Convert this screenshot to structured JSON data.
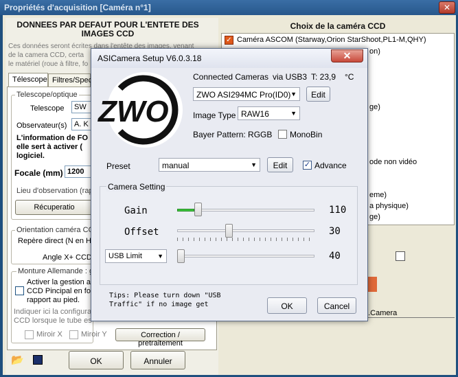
{
  "background_window": {
    "title": "Propriétés d'acquisition [Caméra n°1]",
    "close_glyph": "✕",
    "left_header": "DONNEES PAR DEFAUT POUR L'ENTETE DES IMAGES CCD",
    "intro_line1": "Ces données seront écrites dans l'entête des images, venant",
    "intro_line2": "de la camera CCD, certa",
    "intro_line3": "le matériel (roue à filtre, fo",
    "tabs": [
      "Télescope",
      "Filtres/Spec"
    ],
    "group_telescope": "Telescope/optique",
    "label_telescope": "Telescope",
    "value_telescope": "SW",
    "label_observateur": "Observateur(s)",
    "value_observateur": "A. K",
    "info_line1": "L'information de FO",
    "info_line2": "elle sert à activer (",
    "info_line3": "logiciel.",
    "label_focale": "Focale (mm)",
    "value_focale": "1200",
    "label_lieu": "Lieu d'observation (rap",
    "btn_recuperation": "Récuperatio",
    "group_orientation": "Orientation caméra CCD",
    "repere": "Repère direct (N en H",
    "angle": "Angle X+ CCD",
    "group_monture": "Monture Allemande : g",
    "activer_line1": "Activer la gestion a",
    "activer_line2": "CCD Pincipal en fo",
    "activer_line3": "rapport au pied.",
    "indiquer_line1": "Indiquer ici la configura",
    "indiquer_line2": "CCD lorsque le tube es",
    "miroir_x": "Miroir X",
    "miroir_y": "Miroir Y",
    "btn_correction": "Correction / pretraitement",
    "btn_ok": "OK",
    "btn_annuler": "Annuler",
    "right_header": "Choix de la caméra CCD",
    "camera_list": [
      "Caméra ASCOM (Starway,Orion StarShoot,PL1-M,QHY)",
      "on)",
      "ge)",
      "ode non vidéo",
      "eme)",
      "a physique)",
      "ge)"
    ],
    "camera_footer": "2.Camera"
  },
  "dialog": {
    "title": "ASICamera Setup V6.0.3.18",
    "close_glyph": "✕",
    "logo_text": "ZWO",
    "connected_label": "Connected Cameras",
    "usb_label": "via USB3",
    "temp_label": "T: 23,9",
    "temp_unit": "°C",
    "camera_value": "ZWO ASI294MC Pro(ID0)",
    "edit1": "Edit",
    "image_type_label": "Image Type",
    "image_type_value": "RAW16",
    "bayer": "Bayer Pattern: RGGB",
    "monobin": "MonoBin",
    "preset_label": "Preset",
    "preset_value": "manual",
    "edit2": "Edit",
    "advance": "Advance",
    "advance_checked": true,
    "camera_setting": "Camera Setting",
    "gain_label": "Gain",
    "gain_value": "110",
    "gain_level": 0.13,
    "offset_label": "Offset",
    "offset_value": "30",
    "offset_level": 0.37,
    "usb_select": "USB Limit",
    "usb_value": "40",
    "usb_level": 0.0,
    "tips": "Tips: Please turn down \"USB\nTraffic\" if no image get",
    "ok": "OK",
    "cancel": "Cancel"
  }
}
